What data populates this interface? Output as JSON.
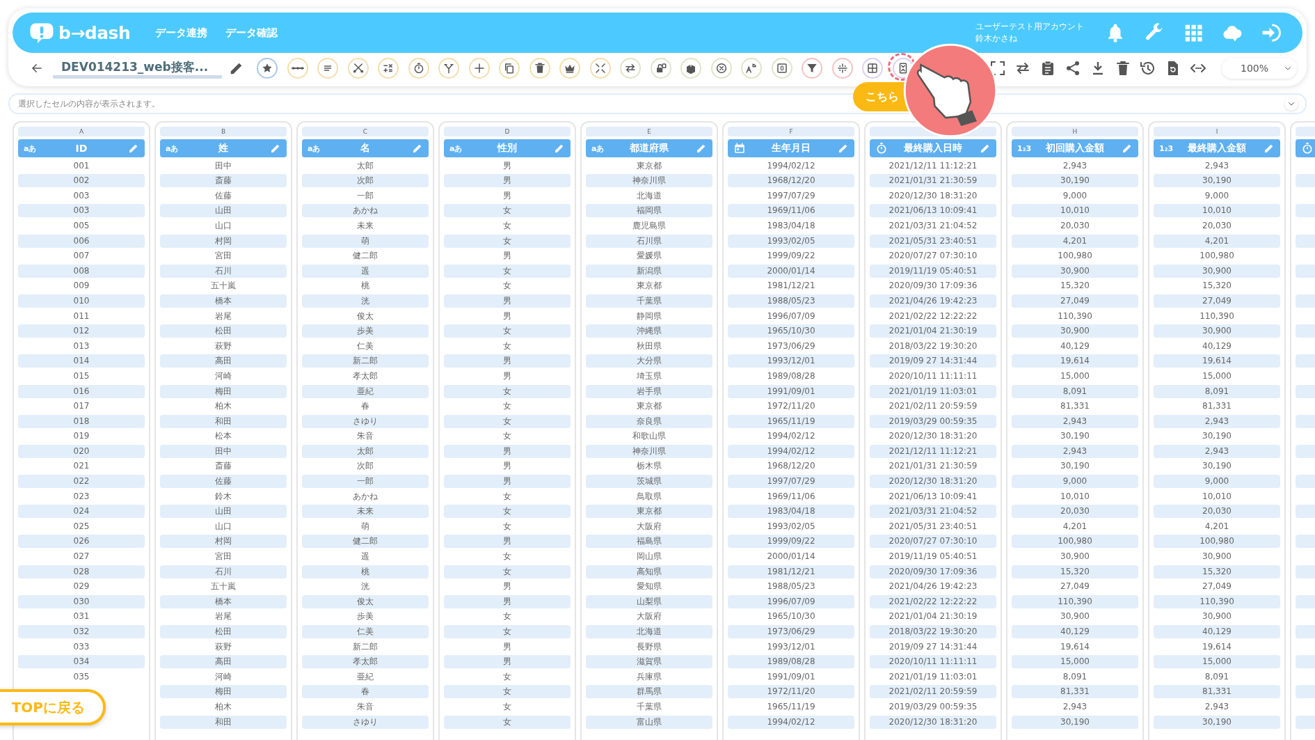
{
  "header": {
    "logo": "b→dash",
    "nav": [
      "データ連携",
      "データ確認"
    ],
    "account": {
      "label": "ユーザーテスト用アカウント",
      "user": "鈴木かさね"
    }
  },
  "toolbar": {
    "title": "DEV014213_web接客...",
    "tools": [
      {
        "color": "#a9c8e8",
        "highlighted": false
      },
      {
        "color": "#f3deac",
        "highlighted": false
      },
      {
        "color": "#f3deac",
        "highlighted": false
      },
      {
        "color": "#f3deac",
        "highlighted": false
      },
      {
        "color": "#f3deac",
        "highlighted": false
      },
      {
        "color": "#f3deac",
        "highlighted": false
      },
      {
        "color": "#f3deac",
        "highlighted": false
      },
      {
        "color": "#f3deac",
        "highlighted": false
      },
      {
        "color": "#f3deac",
        "highlighted": false
      },
      {
        "color": "#f3deac",
        "highlighted": false
      },
      {
        "color": "#f3deac",
        "highlighted": false
      },
      {
        "color": "#f3deac",
        "highlighted": false
      },
      {
        "color": "#dde5c6",
        "highlighted": false
      },
      {
        "color": "#dde5c6",
        "highlighted": false
      },
      {
        "color": "#dde5c6",
        "highlighted": false
      },
      {
        "color": "#dde5c6",
        "highlighted": false
      },
      {
        "color": "#dde5c6",
        "highlighted": false
      },
      {
        "color": "#dde5c6",
        "highlighted": false
      },
      {
        "color": "#f6c1c1",
        "highlighted": false
      },
      {
        "color": "#f6c1c1",
        "highlighted": false
      },
      {
        "color": "#dccff2",
        "highlighted": false
      },
      {
        "color": "#dccff2",
        "highlighted": true
      }
    ],
    "zoom": "100%"
  },
  "cell_bar": {
    "placeholder": "選択したセルの内容が表示されます。"
  },
  "callout": {
    "button": "こちら"
  },
  "table": {
    "columns": [
      {
        "letter": "A",
        "kind": "text",
        "badge": "aあ",
        "label": "ID"
      },
      {
        "letter": "B",
        "kind": "text",
        "badge": "aあ",
        "label": "姓"
      },
      {
        "letter": "C",
        "kind": "text",
        "badge": "aあ",
        "label": "名"
      },
      {
        "letter": "D",
        "kind": "text",
        "badge": "aあ",
        "label": "性別"
      },
      {
        "letter": "E",
        "kind": "text",
        "badge": "aあ",
        "label": "都道府県"
      },
      {
        "letter": "F",
        "kind": "date",
        "label": "生年月日"
      },
      {
        "kind": "datetime",
        "label": "最終購入日時"
      },
      {
        "letter": "H",
        "kind": "number",
        "badge": "1₂3",
        "label": "初回購入金額"
      },
      {
        "letter": "I",
        "kind": "number",
        "badge": "1₂3",
        "label": "最終購入金額"
      }
    ],
    "partial_column": {
      "kind": "datetime"
    },
    "rows": [
      [
        "001",
        "田中",
        "太郎",
        "男",
        "東京都",
        "1994/02/12",
        "2021/12/11 11:12:21",
        "2,943",
        "2,943"
      ],
      [
        "002",
        "斎藤",
        "次郎",
        "男",
        "神奈川県",
        "1968/12/20",
        "2021/01/31 21:30:59",
        "30,190",
        "30,190"
      ],
      [
        "003",
        "佐藤",
        "一郎",
        "男",
        "北海道",
        "1997/07/29",
        "2020/12/30 18:31:20",
        "9,000",
        "9,000"
      ],
      [
        "003",
        "山田",
        "あかね",
        "女",
        "福岡県",
        "1969/11/06",
        "2021/06/13 10:09:41",
        "10,010",
        "10,010"
      ],
      [
        "005",
        "山口",
        "未来",
        "女",
        "鹿児島県",
        "1983/04/18",
        "2021/03/31 21:04:52",
        "20,030",
        "20,030"
      ],
      [
        "006",
        "村岡",
        "萌",
        "女",
        "石川県",
        "1993/02/05",
        "2021/05/31 23:40:51",
        "4,201",
        "4,201"
      ],
      [
        "007",
        "宮田",
        "健二郎",
        "男",
        "愛媛県",
        "1999/09/22",
        "2020/07/27 07:30:10",
        "100,980",
        "100,980"
      ],
      [
        "008",
        "石川",
        "遥",
        "女",
        "新潟県",
        "2000/01/14",
        "2019/11/19 05:40:51",
        "30,900",
        "30,900"
      ],
      [
        "009",
        "五十嵐",
        "桃",
        "女",
        "東京都",
        "1981/12/21",
        "2020/09/30 17:09:36",
        "15,320",
        "15,320"
      ],
      [
        "010",
        "橋本",
        "洸",
        "男",
        "千葉県",
        "1988/05/23",
        "2021/04/26 19:42:23",
        "27,049",
        "27,049"
      ],
      [
        "011",
        "岩尾",
        "俊太",
        "男",
        "静岡県",
        "1996/07/09",
        "2021/02/22 12:22:22",
        "110,390",
        "110,390"
      ],
      [
        "012",
        "松田",
        "歩美",
        "女",
        "沖縄県",
        "1965/10/30",
        "2021/01/04 21:30:19",
        "30,900",
        "30,900"
      ],
      [
        "013",
        "萩野",
        "仁美",
        "女",
        "秋田県",
        "1973/06/29",
        "2018/03/22 19:30:20",
        "40,129",
        "40,129"
      ],
      [
        "014",
        "高田",
        "新二郎",
        "男",
        "大分県",
        "1993/12/01",
        "2019/09 27 14:31:44",
        "19,614",
        "19,614"
      ],
      [
        "015",
        "河崎",
        "孝太郎",
        "男",
        "埼玉県",
        "1989/08/28",
        "2020/10/11 11:11:11",
        "15,000",
        "15,000"
      ],
      [
        "016",
        "梅田",
        "亜紀",
        "女",
        "岩手県",
        "1991/09/01",
        "2021/01/19 11:03:01",
        "8,091",
        "8,091"
      ],
      [
        "017",
        "柏木",
        "春",
        "女",
        "東京都",
        "1972/11/20",
        "2021/02/11 20:59:59",
        "81,331",
        "81,331"
      ],
      [
        "018",
        "和田",
        "さゆり",
        "女",
        "奈良県",
        "1965/11/19",
        "2019/03/29 00:59:35",
        "2,943",
        "2,943"
      ],
      [
        "019",
        "松本",
        "朱音",
        "女",
        "和歌山県",
        "1994/02/12",
        "2020/12/30 18:31:20",
        "30,190",
        "30,190"
      ],
      [
        "020",
        "田中",
        "太郎",
        "男",
        "神奈川県",
        "1994/02/12",
        "2021/12/11 11:12:21",
        "2,943",
        "2,943"
      ],
      [
        "021",
        "斎藤",
        "次郎",
        "男",
        "栃木県",
        "1968/12/20",
        "2021/01/31 21:30:59",
        "30,190",
        "30,190"
      ],
      [
        "022",
        "佐藤",
        "一郎",
        "男",
        "茨城県",
        "1997/07/29",
        "2020/12/30 18:31:20",
        "9,000",
        "9,000"
      ],
      [
        "023",
        "鈴木",
        "あかね",
        "女",
        "鳥取県",
        "1969/11/06",
        "2021/06/13 10:09:41",
        "10,010",
        "10,010"
      ],
      [
        "024",
        "山田",
        "未来",
        "女",
        "東京都",
        "1983/04/18",
        "2021/03/31 21:04:52",
        "20,030",
        "20,030"
      ],
      [
        "025",
        "山口",
        "萌",
        "女",
        "大阪府",
        "1993/02/05",
        "2021/05/31 23:40:51",
        "4,201",
        "4,201"
      ],
      [
        "026",
        "村岡",
        "健二郎",
        "男",
        "福島県",
        "1999/09/22",
        "2020/07/27 07:30:10",
        "100,980",
        "100,980"
      ],
      [
        "027",
        "宮田",
        "遥",
        "女",
        "岡山県",
        "2000/01/14",
        "2019/11/19 05:40:51",
        "30,900",
        "30,900"
      ],
      [
        "028",
        "石川",
        "桃",
        "女",
        "高知県",
        "1981/12/21",
        "2020/09/30 17:09:36",
        "15,320",
        "15,320"
      ],
      [
        "029",
        "五十嵐",
        "洸",
        "男",
        "愛知県",
        "1988/05/23",
        "2021/04/26 19:42:23",
        "27,049",
        "27,049"
      ],
      [
        "030",
        "橋本",
        "俊太",
        "男",
        "山梨県",
        "1996/07/09",
        "2021/02/22 12:22:22",
        "110,390",
        "110,390"
      ],
      [
        "031",
        "岩尾",
        "歩美",
        "女",
        "大阪府",
        "1965/10/30",
        "2021/01/04 21:30:19",
        "30,900",
        "30,900"
      ],
      [
        "032",
        "松田",
        "仁美",
        "女",
        "北海道",
        "1973/06/29",
        "2018/03/22 19:30:20",
        "40,129",
        "40,129"
      ],
      [
        "033",
        "萩野",
        "新二郎",
        "男",
        "長野県",
        "1993/12/01",
        "2019/09 27 14:31:44",
        "19,614",
        "19,614"
      ],
      [
        "034",
        "高田",
        "孝太郎",
        "男",
        "滋賀県",
        "1989/08/28",
        "2020/10/11 11:11:11",
        "15,000",
        "15,000"
      ],
      [
        "035",
        "河崎",
        "亜紀",
        "女",
        "兵庫県",
        "1991/09/01",
        "2021/01/19 11:03:01",
        "8,091",
        "8,091"
      ],
      [
        null,
        "梅田",
        "春",
        "女",
        "群馬県",
        "1972/11/20",
        "2021/02/11 20:59:59",
        "81,331",
        "81,331"
      ],
      [
        null,
        "柏木",
        "朱音",
        "女",
        "千葉県",
        "1965/11/19",
        "2019/03/29 00:59:35",
        "2,943",
        "2,943"
      ],
      [
        null,
        "和田",
        "さゆり",
        "女",
        "富山県",
        "1994/02/12",
        "2020/12/30 18:31:20",
        "30,190",
        "30,190"
      ]
    ]
  },
  "back_to_top": "TOPに戻る"
}
